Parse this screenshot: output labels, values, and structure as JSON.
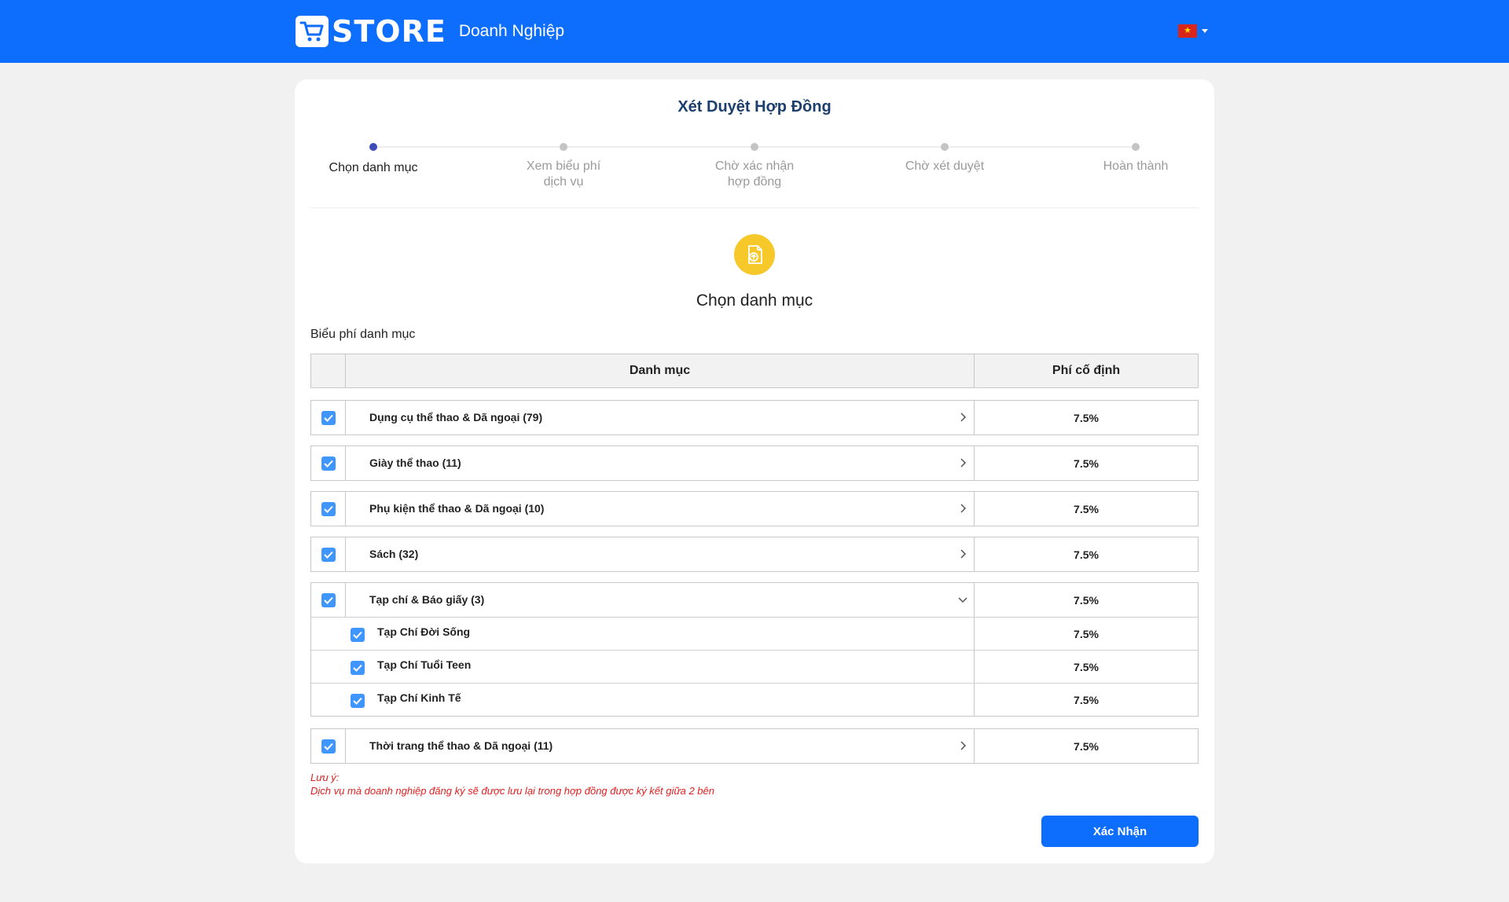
{
  "header": {
    "logo_text": "STORE",
    "logo_sub": "Doanh Nghiệp",
    "brand_color": "#0d6efd",
    "language_flag": "vietnam-flag-icon"
  },
  "page": {
    "title": "Xét Duyệt Hợp Đồng"
  },
  "steps": [
    {
      "label": "Chọn danh mục",
      "active": true
    },
    {
      "label": "Xem biểu phí dịch vụ",
      "active": false
    },
    {
      "label": "Chờ xác nhận hợp đồng",
      "active": false
    },
    {
      "label": "Chờ xét duyệt",
      "active": false
    },
    {
      "label": "Hoàn thành",
      "active": false
    }
  ],
  "section": {
    "icon": "document-upload-icon",
    "title": "Chọn danh mục",
    "table_caption": "Biểu phí danh mục"
  },
  "table": {
    "col_category": "Danh mục",
    "col_fee": "Phí cố định",
    "rows": [
      {
        "name": "Dụng cụ thể thao & Dã ngoại (79)",
        "fee": "7.5%",
        "checked": true,
        "expanded": false
      },
      {
        "name": "Giày thể thao (11)",
        "fee": "7.5%",
        "checked": true,
        "expanded": false
      },
      {
        "name": "Phụ kiện thể thao & Dã ngoại (10)",
        "fee": "7.5%",
        "checked": true,
        "expanded": false
      },
      {
        "name": "Sách (32)",
        "fee": "7.5%",
        "checked": true,
        "expanded": false
      },
      {
        "name": "Tạp chí & Báo giấy (3)",
        "fee": "7.5%",
        "checked": true,
        "expanded": true,
        "children": [
          {
            "name": "Tạp Chí Đời Sống",
            "fee": "7.5%",
            "checked": true
          },
          {
            "name": "Tạp Chí Tuổi Teen",
            "fee": "7.5%",
            "checked": true
          },
          {
            "name": "Tạp Chí Kinh Tế",
            "fee": "7.5%",
            "checked": true
          }
        ]
      },
      {
        "name": "Thời trang thể thao & Dã ngoại (11)",
        "fee": "7.5%",
        "checked": true,
        "expanded": false
      }
    ]
  },
  "note": {
    "title": "Lưu ý:",
    "text": "Dịch vụ mà doanh nghiệp đăng ký sẽ được lưu lại trong hợp đồng được ký kết giữa 2 bên",
    "color": "#e02020"
  },
  "confirm_button": "Xác Nhận"
}
